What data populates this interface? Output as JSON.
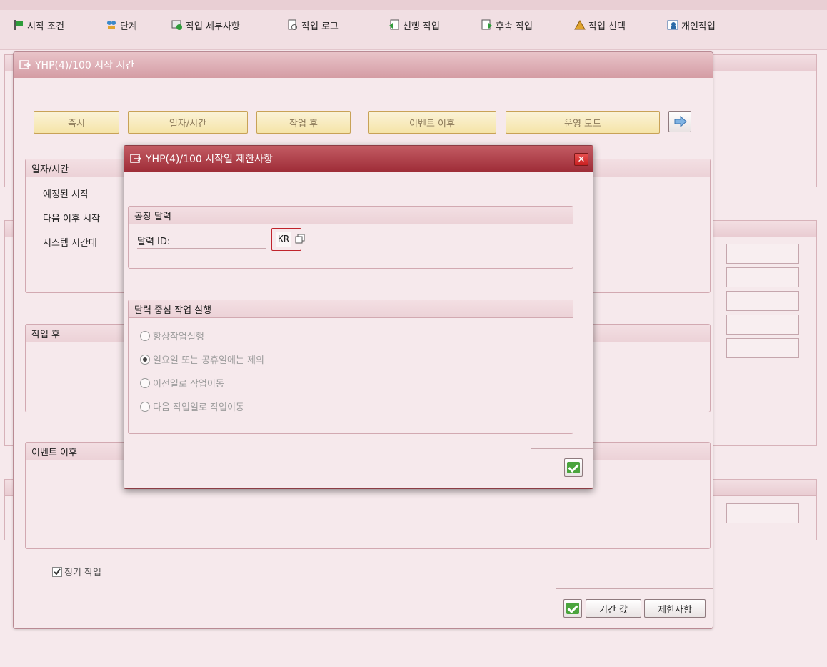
{
  "toolbar": {
    "items": [
      {
        "label": "시작 조건",
        "icon": "flag-icon"
      },
      {
        "label": "단계",
        "icon": "steps-icon"
      },
      {
        "label": "작업 세부사항",
        "icon": "job-details-icon"
      },
      {
        "label": "작업 로그",
        "icon": "job-log-icon"
      },
      {
        "label": "선행 작업",
        "icon": "predecessor-job-icon"
      },
      {
        "label": "후속 작업",
        "icon": "successor-job-icon"
      },
      {
        "label": "작업 선택",
        "icon": "job-selection-icon"
      },
      {
        "label": "개인작업",
        "icon": "own-jobs-icon"
      }
    ]
  },
  "main_dialog": {
    "title": "YHP(4)/100 시작 시간",
    "buttons": {
      "immediate": "즉시",
      "date_time": "일자/시간",
      "after_job": "작업 후",
      "after_event": "이벤트 이후",
      "operation_mode": "운영 모드"
    },
    "date_time_group": {
      "title": "일자/시간",
      "scheduled_start": "예정된 시작",
      "no_start_after": "다음 이후 시작",
      "system_timezone": "시스템 시간대"
    },
    "after_job_group": {
      "title": "작업 후"
    },
    "after_event_group": {
      "title": "이벤트 이후"
    },
    "periodic_job": {
      "label": "정기 작업",
      "checked": true
    },
    "footer": {
      "period_values": "기간 값",
      "restrictions": "제한사항"
    }
  },
  "modal": {
    "title": "YHP(4)/100 시작일 제한사항",
    "factory_calendar": {
      "title": "공장 달력",
      "calendar_id_label": "달력 ID:",
      "calendar_id_value": "KR"
    },
    "job_execution": {
      "title": "달력 중심 작업 실행",
      "options": [
        {
          "label": "항상작업실행",
          "selected": false
        },
        {
          "label": "일요일 또는 공휴일에는 제외",
          "selected": true
        },
        {
          "label": "이전일로 작업이동",
          "selected": false
        },
        {
          "label": "다음 작업일로 작업이동",
          "selected": false
        }
      ]
    }
  },
  "colors": {
    "accent_title": "#a3323c",
    "ok_green": "#4aa43d",
    "button_yellow": "#f5e4a8"
  }
}
